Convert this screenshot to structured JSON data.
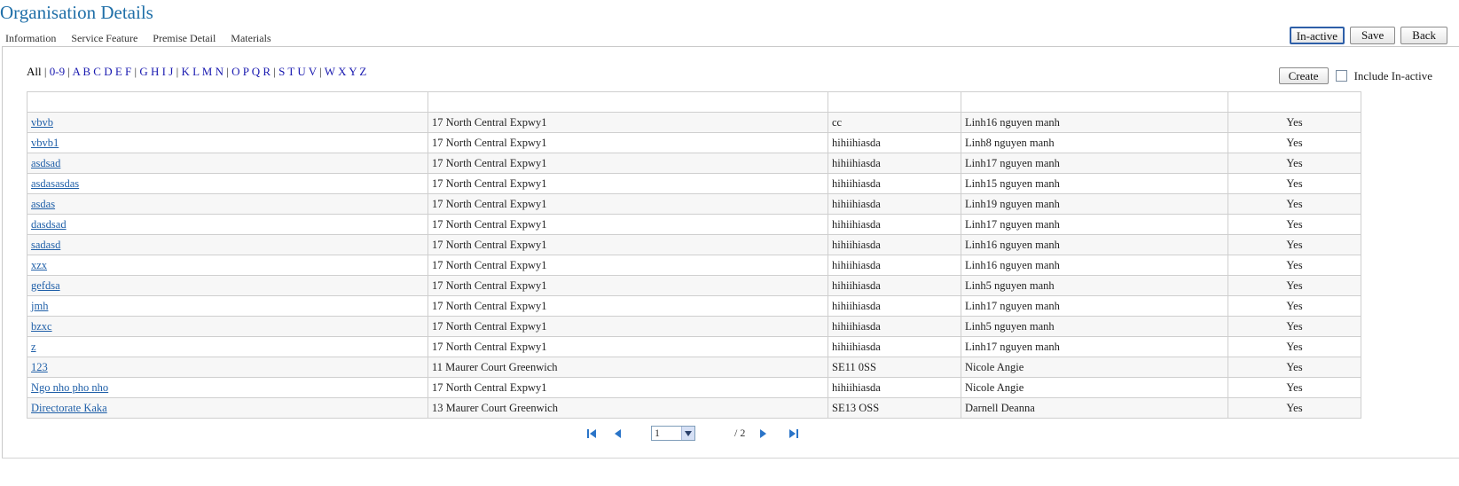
{
  "page": {
    "title": "Organisation Details"
  },
  "tabs": [
    "Information",
    "Service Feature",
    "Premise Detail",
    "Materials"
  ],
  "actions": {
    "inactive_label": "In-active",
    "save_label": "Save",
    "back_label": "Back"
  },
  "alpha_filter": [
    "All",
    "0-9",
    "A B C D E F",
    "G H I J",
    "K L M N",
    "O P Q R",
    "S T U V",
    "W X Y Z"
  ],
  "tools": {
    "create_label": "Create",
    "include_inactive_label": "Include In-active"
  },
  "table": {
    "rows": [
      {
        "name": "vbvb",
        "address": "17 North Central Expwy1",
        "postcode": "cc",
        "contact": "Linh16 nguyen manh",
        "active": "Yes"
      },
      {
        "name": "vbvb1",
        "address": "17 North Central Expwy1",
        "postcode": "hihiihiasda",
        "contact": "Linh8 nguyen manh",
        "active": "Yes"
      },
      {
        "name": "asdsad",
        "address": "17 North Central Expwy1",
        "postcode": "hihiihiasda",
        "contact": "Linh17 nguyen manh",
        "active": "Yes"
      },
      {
        "name": "asdasasdas",
        "address": "17 North Central Expwy1",
        "postcode": "hihiihiasda",
        "contact": "Linh15 nguyen manh",
        "active": "Yes"
      },
      {
        "name": "asdas",
        "address": "17 North Central Expwy1",
        "postcode": "hihiihiasda",
        "contact": "Linh19 nguyen manh",
        "active": "Yes"
      },
      {
        "name": "dasdsad",
        "address": "17 North Central Expwy1",
        "postcode": "hihiihiasda",
        "contact": "Linh17 nguyen manh",
        "active": "Yes"
      },
      {
        "name": "sadasd",
        "address": "17 North Central Expwy1",
        "postcode": "hihiihiasda",
        "contact": "Linh16 nguyen manh",
        "active": "Yes"
      },
      {
        "name": "xzx",
        "address": "17 North Central Expwy1",
        "postcode": "hihiihiasda",
        "contact": "Linh16 nguyen manh",
        "active": "Yes"
      },
      {
        "name": "gefdsa",
        "address": "17 North Central Expwy1",
        "postcode": "hihiihiasda",
        "contact": "Linh5 nguyen manh",
        "active": "Yes"
      },
      {
        "name": "jmh",
        "address": "17 North Central Expwy1",
        "postcode": "hihiihiasda",
        "contact": "Linh17 nguyen manh",
        "active": "Yes"
      },
      {
        "name": "bzxc",
        "address": "17 North Central Expwy1",
        "postcode": "hihiihiasda",
        "contact": "Linh5 nguyen manh",
        "active": "Yes"
      },
      {
        "name": "z",
        "address": "17 North Central Expwy1",
        "postcode": "hihiihiasda",
        "contact": "Linh17 nguyen manh",
        "active": "Yes"
      },
      {
        "name": "123",
        "address": "11 Maurer Court Greenwich",
        "postcode": "SE11 0SS",
        "contact": "Nicole Angie",
        "active": "Yes"
      },
      {
        "name": "Ngo nho pho nho",
        "address": "17 North Central Expwy1",
        "postcode": "hihiihiasda",
        "contact": "Nicole Angie",
        "active": "Yes"
      },
      {
        "name": "Directorate Kaka",
        "address": "13 Maurer Court Greenwich",
        "postcode": "SE13 OSS",
        "contact": "Darnell Deanna",
        "active": "Yes"
      }
    ]
  },
  "pager": {
    "current_page": "1",
    "total_label": "/ 2"
  },
  "icons": {
    "first": "first-page-icon",
    "prev": "prev-page-icon",
    "next": "next-page-icon",
    "last": "last-page-icon",
    "dropdown": "chevron-down-icon"
  },
  "colors": {
    "title": "#1f6fa8",
    "link": "#1f5fa8",
    "alpha_link": "#1a1ab0",
    "pager_icon": "#2a74c8"
  }
}
